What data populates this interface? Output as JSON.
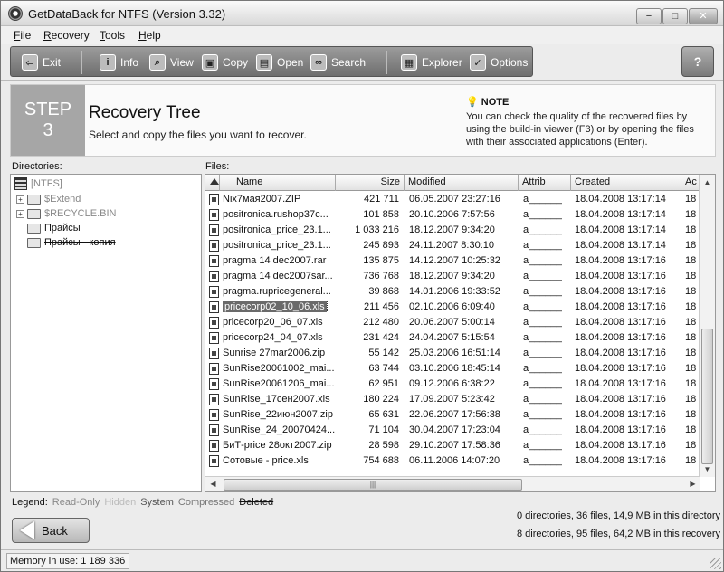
{
  "window": {
    "title": "GetDataBack for NTFS (Version 3.32)",
    "min": "−",
    "max": "□",
    "close": "✕"
  },
  "menu": [
    {
      "u": "F",
      "rest": "ile"
    },
    {
      "u": "R",
      "rest": "ecovery"
    },
    {
      "u": "T",
      "rest": "ools"
    },
    {
      "u": "H",
      "rest": "elp"
    }
  ],
  "toolbar": {
    "exit": "Exit",
    "info": "Info",
    "view": "View",
    "copy": "Copy",
    "open": "Open",
    "search": "Search",
    "explorer": "Explorer",
    "options": "Options",
    "help_glyph": "?"
  },
  "step": {
    "word": "STEP",
    "number": "3",
    "title": "Recovery Tree",
    "subtitle": "Select and copy the files you want to recover.",
    "note_title": "NOTE",
    "note_text": "You can check the quality of the recovered files by using the build-in viewer (F3) or by opening the files with their associated applications (Enter)."
  },
  "directories": {
    "label": "Directories:",
    "items": [
      "[NTFS]",
      "$Extend",
      "$RECYCLE.BIN",
      "Прайсы",
      "Прайсы - копия"
    ]
  },
  "files": {
    "label": "Files:",
    "columns": {
      "name": "Name",
      "size": "Size",
      "modified": "Modified",
      "attrib": "Attrib",
      "created": "Created",
      "accessed": "Ac"
    },
    "rows": [
      {
        "name": "Nix7мая2007.ZIP",
        "size": "421 711",
        "modified": "06.05.2007 23:27:16",
        "attrib": "a______",
        "created": "18.04.2008 13:17:14",
        "acc": "18"
      },
      {
        "name": "positronica.rushop37c...",
        "size": "101 858",
        "modified": "20.10.2006 7:57:56",
        "attrib": "a______",
        "created": "18.04.2008 13:17:14",
        "acc": "18"
      },
      {
        "name": "positronica_price_23.1...",
        "size": "1 033 216",
        "modified": "18.12.2007 9:34:20",
        "attrib": "a______",
        "created": "18.04.2008 13:17:14",
        "acc": "18"
      },
      {
        "name": "positronica_price_23.1...",
        "size": "245 893",
        "modified": "24.11.2007 8:30:10",
        "attrib": "a______",
        "created": "18.04.2008 13:17:14",
        "acc": "18"
      },
      {
        "name": "pragma 14 dec2007.rar",
        "size": "135 875",
        "modified": "14.12.2007 10:25:32",
        "attrib": "a______",
        "created": "18.04.2008 13:17:16",
        "acc": "18"
      },
      {
        "name": "pragma 14 dec2007sar...",
        "size": "736 768",
        "modified": "18.12.2007 9:34:20",
        "attrib": "a______",
        "created": "18.04.2008 13:17:16",
        "acc": "18"
      },
      {
        "name": "pragma.rupricegeneral...",
        "size": "39 868",
        "modified": "14.01.2006 19:33:52",
        "attrib": "a______",
        "created": "18.04.2008 13:17:16",
        "acc": "18"
      },
      {
        "name": "pricecorp02_10_06.xls",
        "size": "211 456",
        "modified": "02.10.2006 6:09:40",
        "attrib": "a______",
        "created": "18.04.2008 13:17:16",
        "acc": "18"
      },
      {
        "name": "pricecorp20_06_07.xls",
        "size": "212 480",
        "modified": "20.06.2007 5:00:14",
        "attrib": "a______",
        "created": "18.04.2008 13:17:16",
        "acc": "18"
      },
      {
        "name": "pricecorp24_04_07.xls",
        "size": "231 424",
        "modified": "24.04.2007 5:15:54",
        "attrib": "a______",
        "created": "18.04.2008 13:17:16",
        "acc": "18"
      },
      {
        "name": "Sunrise 27mar2006.zip",
        "size": "55 142",
        "modified": "25.03.2006 16:51:14",
        "attrib": "a______",
        "created": "18.04.2008 13:17:16",
        "acc": "18"
      },
      {
        "name": "SunRise20061002_mai...",
        "size": "63 744",
        "modified": "03.10.2006 18:45:14",
        "attrib": "a______",
        "created": "18.04.2008 13:17:16",
        "acc": "18"
      },
      {
        "name": "SunRise20061206_mai...",
        "size": "62 951",
        "modified": "09.12.2006 6:38:22",
        "attrib": "a______",
        "created": "18.04.2008 13:17:16",
        "acc": "18"
      },
      {
        "name": "SunRise_17сен2007.xls",
        "size": "180 224",
        "modified": "17.09.2007 5:23:42",
        "attrib": "a______",
        "created": "18.04.2008 13:17:16",
        "acc": "18"
      },
      {
        "name": "SunRise_22июн2007.zip",
        "size": "65 631",
        "modified": "22.06.2007 17:56:38",
        "attrib": "a______",
        "created": "18.04.2008 13:17:16",
        "acc": "18"
      },
      {
        "name": "SunRise_24_20070424...",
        "size": "71 104",
        "modified": "30.04.2007 17:23:04",
        "attrib": "a______",
        "created": "18.04.2008 13:17:16",
        "acc": "18"
      },
      {
        "name": "БиТ-price 28окт2007.zip",
        "size": "28 598",
        "modified": "29.10.2007 17:58:36",
        "attrib": "a______",
        "created": "18.04.2008 13:17:16",
        "acc": "18"
      },
      {
        "name": "Сотовые - price.xls",
        "size": "754 688",
        "modified": "06.11.2006 14:07:20",
        "attrib": "a______",
        "created": "18.04.2008 13:17:16",
        "acc": "18"
      }
    ],
    "selected_index": 7
  },
  "legend": {
    "label": "Legend:",
    "read_only": "Read-Only",
    "hidden": "Hidden",
    "system": "System",
    "compressed": "Compressed",
    "deleted": "Deleted"
  },
  "back_label": "Back",
  "stats": {
    "directory": "0 directories, 36 files, 14,9 MB in this directory",
    "recovery": "8 directories, 95 files, 64,2 MB in this recovery"
  },
  "status": {
    "memory": "Memory in use: 1 189 336"
  }
}
